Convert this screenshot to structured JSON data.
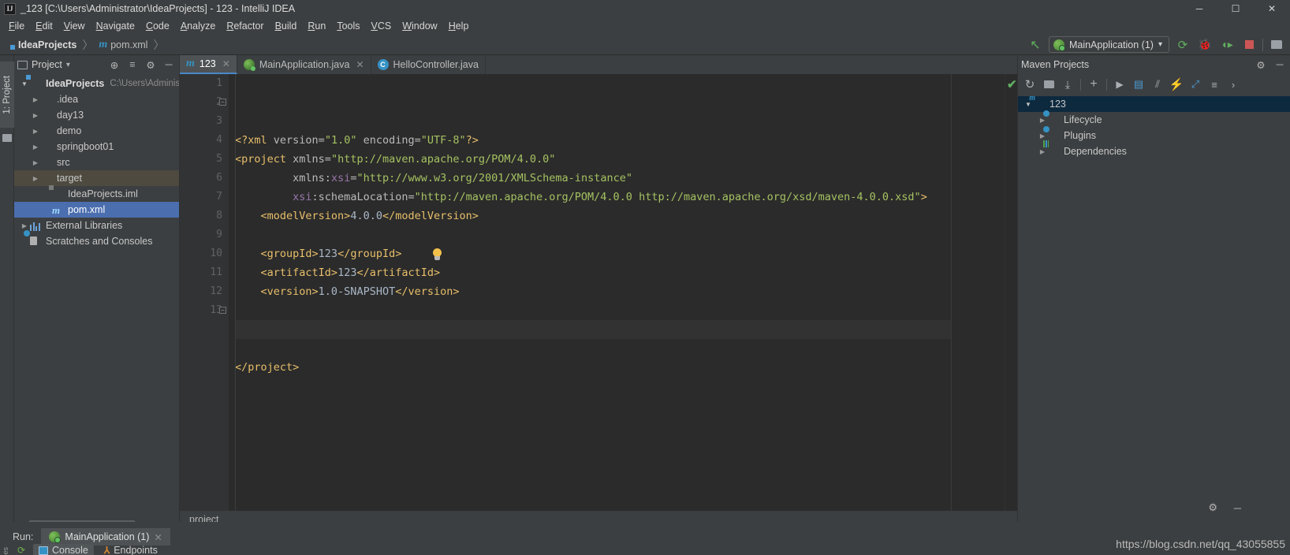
{
  "window": {
    "title": "_123 [C:\\Users\\Administrator\\IdeaProjects] - 123 - IntelliJ IDEA",
    "logo": "IJ",
    "minimize": "─",
    "maximize": "☐",
    "close": "✕"
  },
  "menubar": [
    {
      "label": "File"
    },
    {
      "label": "Edit"
    },
    {
      "label": "View"
    },
    {
      "label": "Navigate"
    },
    {
      "label": "Code"
    },
    {
      "label": "Analyze"
    },
    {
      "label": "Refactor"
    },
    {
      "label": "Build"
    },
    {
      "label": "Run"
    },
    {
      "label": "Tools"
    },
    {
      "label": "VCS"
    },
    {
      "label": "Window"
    },
    {
      "label": "Help"
    }
  ],
  "toolbar": {
    "breadcrumb": [
      {
        "label": "IdeaProjects",
        "icon": "module-icon"
      },
      {
        "label": "pom.xml",
        "icon": "maven-m-icon"
      }
    ],
    "separator": "〉",
    "back_arrow": "↖",
    "run_config": {
      "label": "MainApplication (1)",
      "icon": "spring-boot-icon",
      "chevron": "▾"
    },
    "actions": [
      {
        "name": "run-button",
        "glyph": "▶",
        "color": "#5fae5f"
      },
      {
        "name": "debug-button",
        "glyph": "☠",
        "color": "#5fae5f"
      },
      {
        "name": "run-coverage-button",
        "glyph": "⟳",
        "color": "#5fae5f"
      },
      {
        "name": "stop-button",
        "glyph": "■",
        "color": "#cc5656"
      },
      {
        "name": "project-structure-button",
        "glyph": "▤",
        "color": "#9aa0a6"
      }
    ]
  },
  "left_rail": {
    "label": "1: Project",
    "folder_icon": "folder-icon"
  },
  "project_panel": {
    "title": "Project",
    "chevron": "▾",
    "header_icons": [
      {
        "name": "locate-icon",
        "glyph": "⊕"
      },
      {
        "name": "collapse-all-icon",
        "glyph": "≡"
      },
      {
        "name": "settings-gear-icon",
        "glyph": "⚙"
      },
      {
        "name": "hide-icon",
        "glyph": "─"
      }
    ],
    "tree": [
      {
        "label": "IdeaProjects",
        "path": "C:\\Users\\Adminis",
        "indent": 0,
        "arrow": "open",
        "icon": "module-icon",
        "bold": true,
        "state": "normal"
      },
      {
        "label": ".idea",
        "indent": 1,
        "arrow": "closed",
        "icon": "folder-icon",
        "state": "normal"
      },
      {
        "label": "day13",
        "indent": 1,
        "arrow": "closed",
        "icon": "folder-icon",
        "state": "normal"
      },
      {
        "label": "demo",
        "indent": 1,
        "arrow": "closed",
        "icon": "folder-icon",
        "state": "normal"
      },
      {
        "label": "springboot01",
        "indent": 1,
        "arrow": "closed",
        "icon": "folder-icon",
        "state": "normal"
      },
      {
        "label": "src",
        "indent": 1,
        "arrow": "closed",
        "icon": "folder-icon",
        "state": "normal"
      },
      {
        "label": "target",
        "indent": 1,
        "arrow": "closed",
        "icon": "folder-orange-icon",
        "state": "highlight"
      },
      {
        "label": "IdeaProjects.iml",
        "indent": 2,
        "arrow": "none",
        "icon": "iml-file-icon",
        "state": "normal"
      },
      {
        "label": "pom.xml",
        "indent": 2,
        "arrow": "none",
        "icon": "maven-m-icon",
        "state": "selected"
      },
      {
        "label": "External Libraries",
        "indent": 0,
        "arrow": "closed",
        "icon": "library-icon",
        "state": "normal"
      },
      {
        "label": "Scratches and Consoles",
        "indent": 0,
        "arrow": "none",
        "icon": "scratches-icon",
        "state": "normal"
      }
    ]
  },
  "editor": {
    "tabs": [
      {
        "label": "123",
        "icon": "maven-m-icon",
        "active": true,
        "closable": true
      },
      {
        "label": "MainApplication.java",
        "icon": "spring-boot-icon",
        "active": false,
        "closable": true
      },
      {
        "label": "HelloController.java",
        "icon": "class-c-icon",
        "active": false,
        "closable": false
      }
    ],
    "inspection_status": "✔",
    "lightbulb_icon": "intention-bulb-icon",
    "current_line": 11,
    "breadcrumb": "project",
    "lines": [
      {
        "n": 1,
        "tokens": [
          {
            "t": "tag",
            "s": "<?xml "
          },
          {
            "t": "attr",
            "s": "version="
          },
          {
            "t": "val",
            "s": "\"1.0\""
          },
          {
            "t": "attr",
            "s": " encoding="
          },
          {
            "t": "val",
            "s": "\"UTF-8\""
          },
          {
            "t": "tag",
            "s": "?>"
          }
        ]
      },
      {
        "n": 2,
        "fold": true,
        "tokens": [
          {
            "t": "tag",
            "s": "<project "
          },
          {
            "t": "attr",
            "s": "xmlns="
          },
          {
            "t": "val",
            "s": "\"http://maven.apache.org/POM/4.0.0\""
          }
        ]
      },
      {
        "n": 3,
        "tokens": [
          {
            "t": "txt",
            "s": "         "
          },
          {
            "t": "attr",
            "s": "xmlns:"
          },
          {
            "t": "attrx",
            "s": "xsi"
          },
          {
            "t": "attr",
            "s": "="
          },
          {
            "t": "val",
            "s": "\"http://www.w3.org/2001/XMLSchema-instance\""
          }
        ]
      },
      {
        "n": 4,
        "tokens": [
          {
            "t": "txt",
            "s": "         "
          },
          {
            "t": "attrx",
            "s": "xsi"
          },
          {
            "t": "attr",
            "s": ":schemaLocation="
          },
          {
            "t": "val",
            "s": "\"http://maven.apache.org/POM/4.0.0 http://maven.apache.org/xsd/maven-4.0.0.xsd\""
          },
          {
            "t": "tag",
            "s": ">"
          }
        ]
      },
      {
        "n": 5,
        "tokens": [
          {
            "t": "txt",
            "s": "    "
          },
          {
            "t": "tag",
            "s": "<modelVersion>"
          },
          {
            "t": "txt",
            "s": "4.0.0"
          },
          {
            "t": "tag",
            "s": "</modelVersion>"
          }
        ]
      },
      {
        "n": 6,
        "tokens": []
      },
      {
        "n": 7,
        "tokens": [
          {
            "t": "txt",
            "s": "    "
          },
          {
            "t": "tag",
            "s": "<groupId>"
          },
          {
            "t": "txt",
            "s": "123"
          },
          {
            "t": "tag",
            "s": "</groupId>"
          }
        ]
      },
      {
        "n": 8,
        "tokens": [
          {
            "t": "txt",
            "s": "    "
          },
          {
            "t": "tag",
            "s": "<artifactId>"
          },
          {
            "t": "txt",
            "s": "123"
          },
          {
            "t": "tag",
            "s": "</artifactId>"
          }
        ]
      },
      {
        "n": 9,
        "tokens": [
          {
            "t": "txt",
            "s": "    "
          },
          {
            "t": "tag",
            "s": "<version>"
          },
          {
            "t": "txt",
            "s": "1.0-SNAPSHOT"
          },
          {
            "t": "tag",
            "s": "</version>"
          }
        ]
      },
      {
        "n": 10,
        "tokens": []
      },
      {
        "n": 11,
        "tokens": []
      },
      {
        "n": 12,
        "tokens": []
      },
      {
        "n": 13,
        "fold": true,
        "tokens": [
          {
            "t": "tag",
            "s": "</project>"
          }
        ]
      }
    ]
  },
  "maven_panel": {
    "title": "Maven Projects",
    "header_icons": [
      {
        "name": "settings-gear-icon",
        "glyph": "⚙"
      },
      {
        "name": "hide-icon",
        "glyph": "─"
      }
    ],
    "toolbar_icons": [
      {
        "name": "reimport-icon",
        "glyph": "↻"
      },
      {
        "name": "generate-sources-icon",
        "glyph": "▤"
      },
      {
        "name": "download-sources-icon",
        "glyph": "⤓"
      },
      {
        "name": "add-maven-project-icon",
        "glyph": "+"
      },
      {
        "name": "run-maven-build-icon",
        "glyph": "▶"
      },
      {
        "name": "execute-goal-icon",
        "glyph": "▤"
      },
      {
        "name": "toggle-skip-tests-icon",
        "glyph": "⫽"
      },
      {
        "name": "toggle-offline-icon",
        "glyph": "⚡"
      },
      {
        "name": "expand-icon",
        "glyph": "⤢"
      },
      {
        "name": "collapse-all-icon",
        "glyph": "≡"
      },
      {
        "name": "more-icon",
        "glyph": "›"
      }
    ],
    "tree": [
      {
        "label": "123",
        "indent": 0,
        "arrow": "open",
        "icon": "maven-project-icon",
        "state": "selected"
      },
      {
        "label": "Lifecycle",
        "indent": 1,
        "arrow": "closed",
        "icon": "phase-icon",
        "state": "normal"
      },
      {
        "label": "Plugins",
        "indent": 1,
        "arrow": "closed",
        "icon": "phase-icon",
        "state": "normal"
      },
      {
        "label": "Dependencies",
        "indent": 1,
        "arrow": "closed",
        "icon": "dependencies-icon",
        "state": "normal"
      }
    ]
  },
  "bottom_panel": {
    "run_label": "Run:",
    "run_tab": {
      "label": "MainApplication (1)",
      "icon": "spring-boot-icon",
      "close": "✕"
    },
    "rerun_icon": "rerun-icon",
    "views": [
      {
        "label": "Console",
        "icon": "console-icon",
        "active": true
      },
      {
        "label": "Endpoints",
        "icon": "endpoints-icon",
        "active": false
      }
    ],
    "side_label": "es"
  },
  "watermark": "https://blog.csdn.net/qq_43055855",
  "bottom_right_icons": [
    {
      "name": "settings-gear-icon",
      "glyph": "⚙"
    },
    {
      "name": "hide-icon",
      "glyph": "─"
    }
  ],
  "colors": {
    "accent_blue": "#4b6eaf",
    "editor_bg": "#2b2b2b",
    "panel_bg": "#3c3f41",
    "tag": "#e8bf6a",
    "value": "#a5c261",
    "namespace": "#9876aa",
    "text": "#a9b7c6"
  }
}
